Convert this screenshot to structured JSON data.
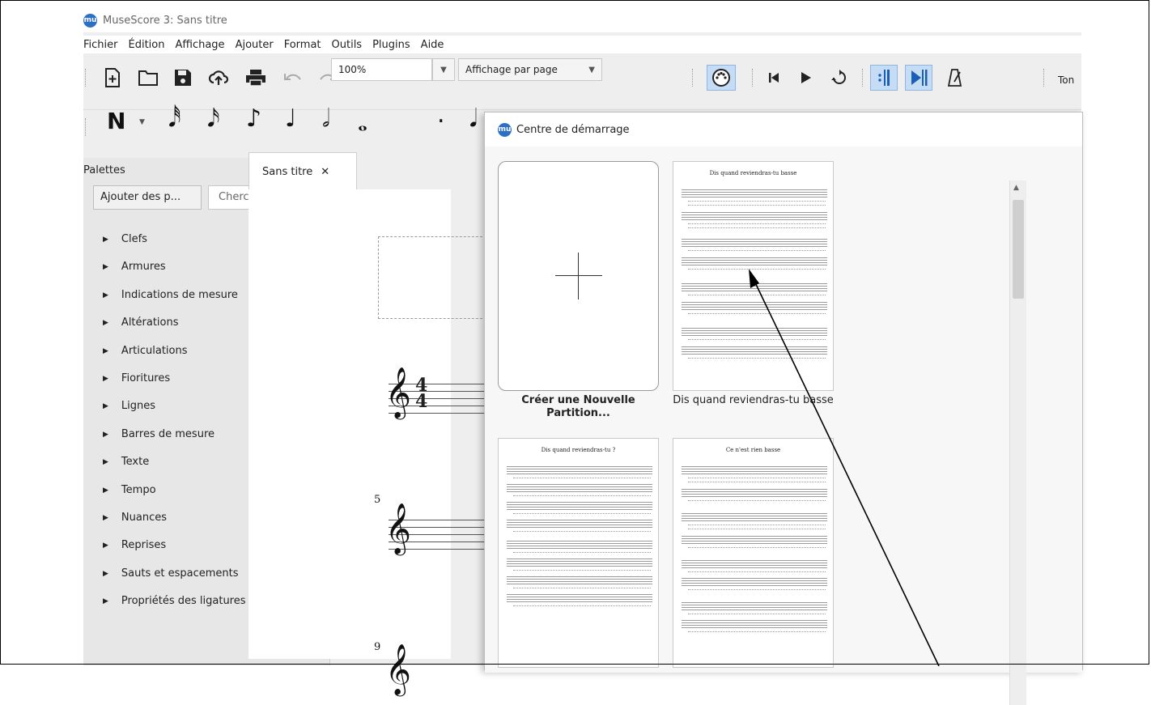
{
  "window": {
    "title": "MuseScore 3: Sans titre",
    "logo_text": "mu"
  },
  "menu": [
    "Fichier",
    "Édition",
    "Affichage",
    "Ajouter",
    "Format",
    "Outils",
    "Plugins",
    "Aide"
  ],
  "toolbar": {
    "zoom_value": "100%",
    "view_mode": "Affichage par page",
    "tonality_cut": "Ton",
    "icons": [
      "new-file-icon",
      "open-folder-icon",
      "save-icon",
      "cloud-upload-icon",
      "print-icon",
      "undo-icon",
      "redo-icon",
      "midi-input-icon",
      "rewind-icon",
      "play-icon",
      "loop-icon",
      "loop-in-icon",
      "loop-out-icon",
      "metronome-icon"
    ]
  },
  "note_input": {
    "mode_label": "N",
    "note_glyphs": [
      "𝅘𝅥𝅰",
      "𝅘𝅥𝅯",
      "♪",
      "♩",
      "𝅗𝅥",
      "𝅝",
      ".",
      "𝅘𝅥"
    ]
  },
  "palettes": {
    "title": "Palettes",
    "add_button": "Ajouter des p...",
    "search_placeholder": "Chercher",
    "float_glyph": "⤢",
    "close_glyph": "×",
    "items": [
      "Clefs",
      "Armures",
      "Indications de mesure",
      "Altérations",
      "Articulations",
      "Fioritures",
      "Lignes",
      "Barres de mesure",
      "Texte",
      "Tempo",
      "Nuances",
      "Reprises",
      "Sauts et espacements",
      "Propriétés des ligatures"
    ]
  },
  "score_tab": {
    "label": "Sans titre",
    "close_glyph": "✕"
  },
  "score": {
    "time_signature_top": "4",
    "time_signature_bottom": "4",
    "measure_numbers": [
      "5",
      "9"
    ],
    "clef_glyph": "𝄞"
  },
  "start_center": {
    "title": "Centre de démarrage",
    "cards": [
      {
        "caption": "Créer une Nouvelle Partition...",
        "bold": true
      },
      {
        "caption": "Dis quand reviendras-tu basse",
        "thumb_title": "Dis quand reviendras-tu basse"
      },
      {
        "caption": "",
        "thumb_title": "Dis quand reviendras-tu ?"
      },
      {
        "caption": "",
        "thumb_title": "Ce n'est rien basse"
      }
    ]
  }
}
